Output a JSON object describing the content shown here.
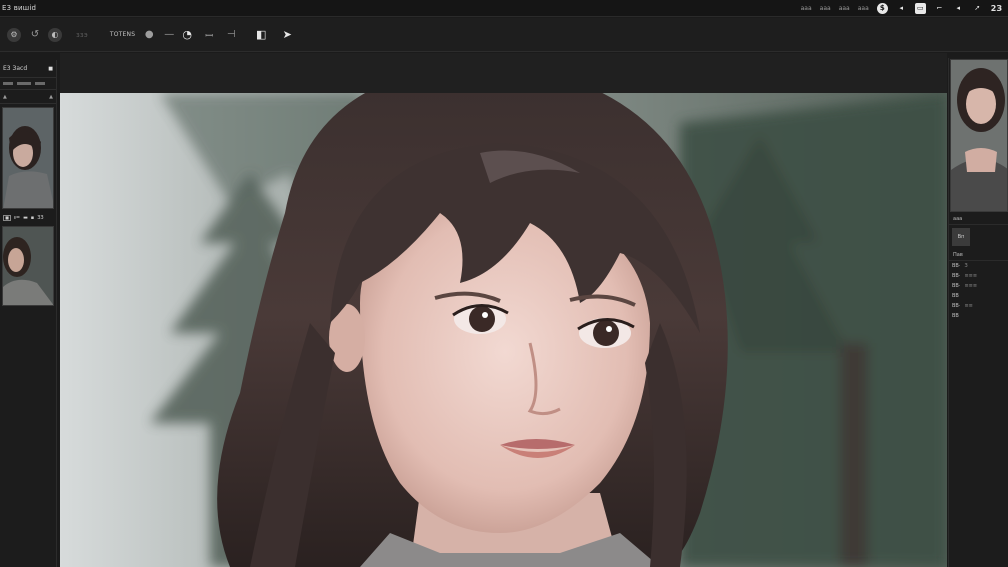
{
  "titlebar": {
    "app_name": "E3 вишіd",
    "right_texts": [
      "ааа",
      "ааа",
      "ааа",
      "ааа"
    ],
    "zoom_label": "2З"
  },
  "toolbar": {
    "dim_label": "ззэ",
    "tools_label": "ТОТЕNS"
  },
  "left_panel": {
    "header": "Е3 Засd",
    "row1": [
      "▲",
      "▲"
    ],
    "caption": [
      "▪",
      "ᵻ=",
      "▬",
      "▪",
      "ЗЗ"
    ]
  },
  "right_panel": {
    "label1": "ааа",
    "label2": "Вп",
    "label3": "Пав",
    "lines": [
      {
        "k": "ВВ·",
        "v": "З"
      },
      {
        "k": "ВВ·",
        "v": "≡≡≡"
      },
      {
        "k": "ВВ·",
        "v": "≡≡≡"
      },
      {
        "k": "ВВ",
        "v": ""
      },
      {
        "k": "ВВ·",
        "v": "≡≡"
      },
      {
        "k": "ВВ",
        "v": ""
      }
    ]
  },
  "colors": {
    "background": "#1b1b1b",
    "panel": "#1c1c1c",
    "accent": "#e8e8e8"
  }
}
